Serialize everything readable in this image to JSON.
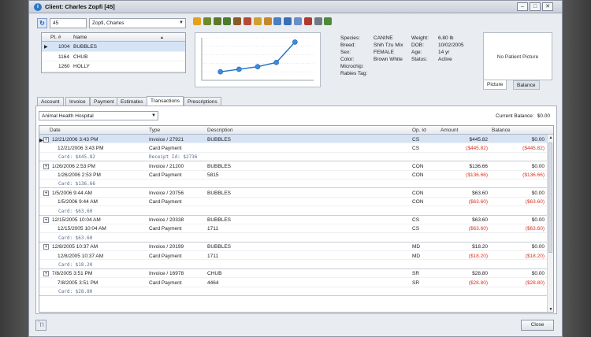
{
  "window": {
    "title": "Client: Charles Zopfi [45]",
    "app_icon": "info-circle-icon"
  },
  "client": {
    "id_value": "45",
    "name_value": "Zopfi, Charles"
  },
  "toolbar_icons": [
    {
      "name": "new-record-icon",
      "color": "#e2a21b"
    },
    {
      "name": "bird-icon",
      "color": "#6f8b2c"
    },
    {
      "name": "bird-edit-icon",
      "color": "#5c7a2a"
    },
    {
      "name": "bird-check-icon",
      "color": "#4e7a2f"
    },
    {
      "name": "lab-icon",
      "color": "#8b5a2b"
    },
    {
      "name": "people-icon",
      "color": "#b54a3a"
    },
    {
      "name": "note-edit-icon",
      "color": "#d0a030"
    },
    {
      "name": "tag-icon",
      "color": "#c9862c"
    },
    {
      "name": "document-icon",
      "color": "#4a7fc1"
    },
    {
      "name": "globe-icon",
      "color": "#3a6fb5"
    },
    {
      "name": "card-icon",
      "color": "#6a8fc8"
    },
    {
      "name": "box-icon",
      "color": "#b03a2e"
    },
    {
      "name": "print-icon",
      "color": "#6f7a86"
    },
    {
      "name": "bird-add-icon",
      "color": "#4d8a3a"
    }
  ],
  "patients": {
    "headers": {
      "num": "Pt. #",
      "name": "Name"
    },
    "rows": [
      {
        "num": "1004",
        "name": "BUBBLES"
      },
      {
        "num": "1164",
        "name": "CHUB"
      },
      {
        "num": "1260",
        "name": "HOLLY"
      }
    ]
  },
  "weight_chart": {
    "chart_data": {
      "type": "line",
      "series": [
        {
          "values": [
            1.0,
            1.3,
            1.6,
            2.1,
            4.5
          ]
        }
      ],
      "x": [
        1,
        2,
        3,
        4,
        5
      ]
    }
  },
  "patient_info": {
    "species_label": "Species:",
    "species": "CANINE",
    "breed_label": "Breed:",
    "breed": "Shih Tzu Mix",
    "sex_label": "Sex:",
    "sex": "FEMALE",
    "color_label": "Color:",
    "color": "Brown White",
    "microchip_label": "Microchip:",
    "rabies_label": "Rabies Tag:",
    "weight_label": "Weight:",
    "weight": "6.80 lb",
    "dob_label": "DOB:",
    "dob": "10/02/2005",
    "age_label": "Age:",
    "age": "14 yr",
    "status_label": "Status:",
    "status": "Active"
  },
  "picture": {
    "placeholder": "No Patient Picture",
    "tabs": [
      "Picture",
      "Balance"
    ]
  },
  "tabs": [
    "Account",
    "Invoice",
    "Payment",
    "Estimates",
    "Transactions",
    "Prescriptions"
  ],
  "transactions": {
    "hospital": "Animal Health Hospital",
    "current_balance_label": "Current Balance:",
    "current_balance": "$0.00",
    "headers": {
      "date": "Date",
      "type": "Type",
      "desc": "Description",
      "op": "Op. Id",
      "amount": "Amount",
      "balance": "Balance"
    },
    "rows": [
      {
        "kind": "main",
        "sel": true,
        "date": "12/21/2006 3:43 PM",
        "type": "Invoice / 27921",
        "desc": "BUBBLES",
        "op": "CS",
        "amount": "$445.82",
        "balance": "$0.00"
      },
      {
        "kind": "sub",
        "date": "12/21/2006 3:43 PM",
        "type": "Card Payment",
        "desc": "",
        "op": "CS",
        "amount": "($445.82)",
        "balance": "($445.82)"
      },
      {
        "kind": "card",
        "card": "Card: $445.82",
        "receipt": "Receipt Id: $2736"
      },
      {
        "kind": "main",
        "date": "1/26/2006 2:53 PM",
        "type": "Invoice / 21200",
        "desc": "BUBBLES",
        "op": "CON",
        "amount": "$136.66",
        "balance": "$0.00"
      },
      {
        "kind": "sub",
        "date": "1/26/2006 2:53 PM",
        "type": "Card Payment",
        "desc": "5815",
        "op": "CON",
        "amount": "($136.66)",
        "balance": "($136.66)"
      },
      {
        "kind": "card",
        "card": "Card: $136.66"
      },
      {
        "kind": "main",
        "date": "1/5/2006 9:44 AM",
        "type": "Invoice / 20756",
        "desc": "BUBBLES",
        "op": "CON",
        "amount": "$63.60",
        "balance": "$0.00"
      },
      {
        "kind": "sub",
        "date": "1/5/2006 9:44 AM",
        "type": "Card Payment",
        "desc": "",
        "op": "CON",
        "amount": "($63.60)",
        "balance": "($63.60)"
      },
      {
        "kind": "card",
        "card": "Card: $63.60"
      },
      {
        "kind": "main",
        "date": "12/15/2005 10:04 AM",
        "type": "Invoice / 20338",
        "desc": "BUBBLES",
        "op": "CS",
        "amount": "$63.60",
        "balance": "$0.00"
      },
      {
        "kind": "sub",
        "date": "12/15/2005 10:04 AM",
        "type": "Card Payment",
        "desc": "1711",
        "op": "CS",
        "amount": "($63.60)",
        "balance": "($63.60)"
      },
      {
        "kind": "card",
        "card": "Card: $63.60"
      },
      {
        "kind": "main",
        "date": "12/8/2005 10:37 AM",
        "type": "Invoice / 20199",
        "desc": "BUBBLES",
        "op": "MD",
        "amount": "$18.20",
        "balance": "$0.00"
      },
      {
        "kind": "sub",
        "date": "12/8/2005 10:37 AM",
        "type": "Card Payment",
        "desc": "1711",
        "op": "MD",
        "amount": "($18.20)",
        "balance": "($18.20)"
      },
      {
        "kind": "card",
        "card": "Card: $18.20"
      },
      {
        "kind": "main",
        "date": "7/8/2005 3:51 PM",
        "type": "Invoice / 16978",
        "desc": "CHUB",
        "op": "SR",
        "amount": "$28.80",
        "balance": "$0.00"
      },
      {
        "kind": "sub",
        "date": "7/8/2005 3:51 PM",
        "type": "Card Payment",
        "desc": "4464",
        "op": "SR",
        "amount": "($28.80)",
        "balance": "($28.80)"
      },
      {
        "kind": "card",
        "card": "Card: $28.80"
      }
    ]
  },
  "footer": {
    "close_label": "Close"
  }
}
